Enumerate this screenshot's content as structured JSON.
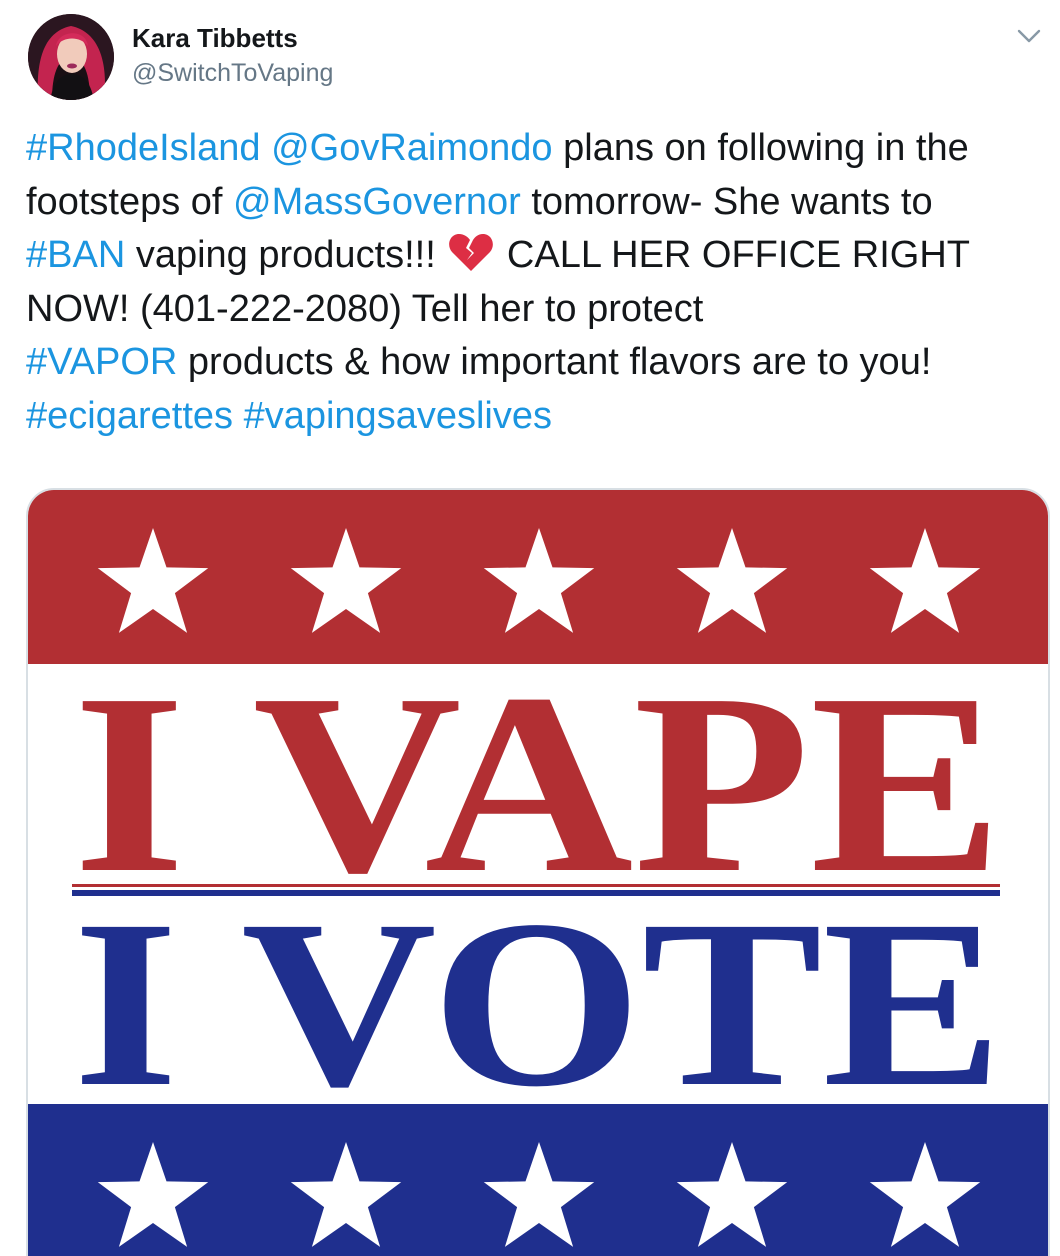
{
  "author": {
    "name": "Kara Tibbetts",
    "handle": "@SwitchToVaping"
  },
  "tweet": {
    "lines": [
      [
        {
          "text": "#RhodeIsland",
          "link": true
        },
        {
          "text": " ",
          "link": false
        },
        {
          "text": "@GovRaimondo",
          "link": true
        },
        {
          "text": " plans on following in the",
          "link": false
        }
      ],
      [
        {
          "text": "footsteps of ",
          "link": false
        },
        {
          "text": "@MassGovernor",
          "link": true
        },
        {
          "text": " tomorrow- She wants to",
          "link": false
        }
      ],
      [
        {
          "text": "#BAN",
          "link": true
        },
        {
          "text": " vaping products!!! ",
          "link": false
        },
        {
          "emoji": "broken-heart-icon"
        },
        {
          "text": " CALL HER OFFICE RIGHT",
          "link": false
        }
      ],
      [
        {
          "text": "NOW! (401-222-2080) Tell her to protect",
          "link": false
        }
      ],
      [
        {
          "text": "#VAPOR",
          "link": true
        },
        {
          "text": " products & how important flavors are to you!",
          "link": false
        }
      ],
      [
        {
          "text": "#ecigarettes",
          "link": true
        },
        {
          "text": " ",
          "link": false
        },
        {
          "text": "#vapingsaveslives",
          "link": true
        }
      ]
    ]
  },
  "media": {
    "line1": "I VAPE",
    "line2": "I VOTE",
    "top_star_count": 5,
    "bottom_star_count": 5
  },
  "icons": {
    "menu": "chevron-down-icon",
    "emoji": "broken-heart-icon"
  },
  "colors": {
    "link": "#1b95e0",
    "text": "#14171a",
    "secondary": "#657786",
    "poster_red": "#b22f33",
    "poster_blue": "#1f2f8e"
  }
}
